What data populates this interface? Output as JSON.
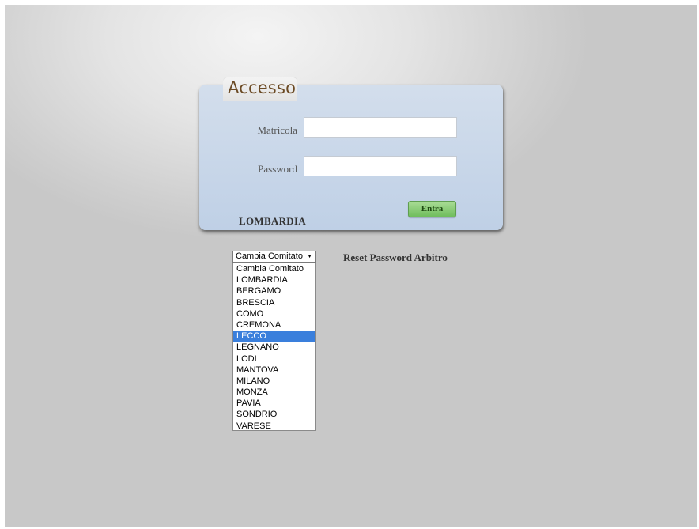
{
  "login": {
    "tab_title": "Accesso",
    "matricola_label": "Matricola",
    "matricola_value": "",
    "password_label": "Password",
    "password_value": "",
    "submit_label": "Entra",
    "region_name": "LOMBARDIA"
  },
  "comitato_select": {
    "selected_label": "Cambia Comitato",
    "highlighted": "LECCO",
    "options": [
      "Cambia Comitato",
      "LOMBARDIA",
      "BERGAMO",
      "BRESCIA",
      "COMO",
      "CREMONA",
      "LECCO",
      "LEGNANO",
      "LODI",
      "MANTOVA",
      "MILANO",
      "MONZA",
      "PAVIA",
      "SONDRIO",
      "VARESE"
    ]
  },
  "reset_link": "Reset Password Arbitro",
  "colors": {
    "panel": "#c9d8eb",
    "button": "#84c96e",
    "highlight": "#3a7fdc",
    "tab_text": "#6b4a24"
  }
}
